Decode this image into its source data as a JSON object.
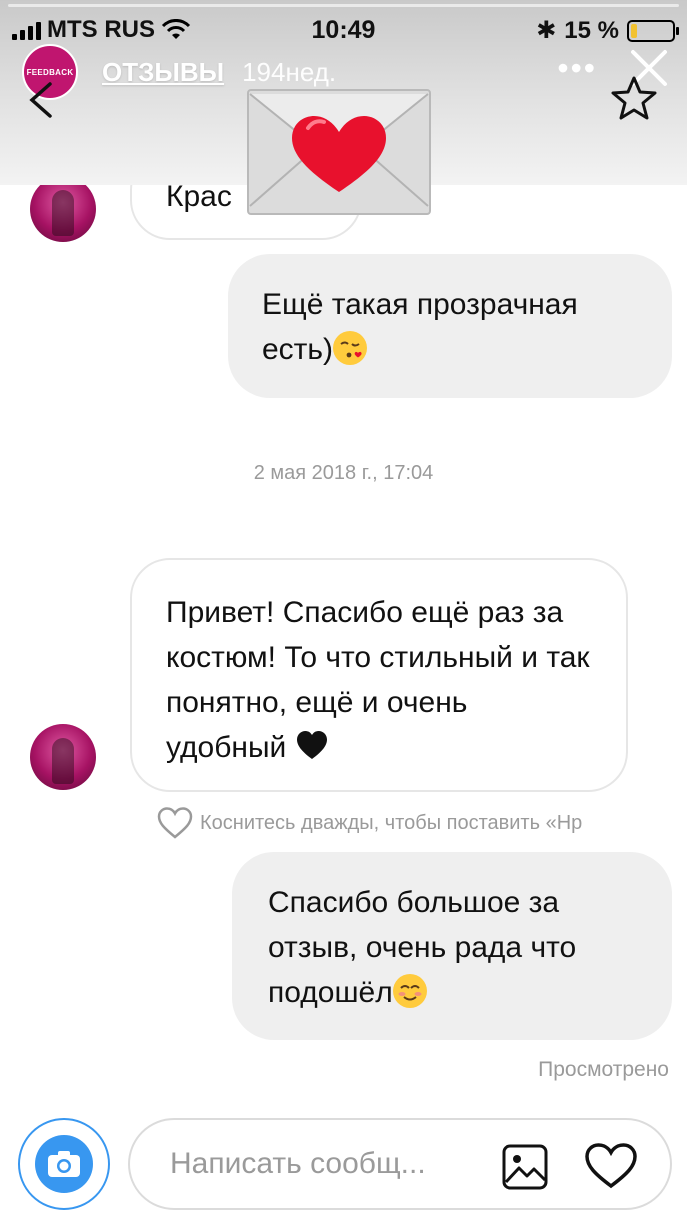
{
  "status_bar": {
    "carrier": "MTS RUS",
    "time": "10:49",
    "battery": "15 %",
    "battery_level": 0.15
  },
  "story": {
    "avatar_label": "FEEDBACK",
    "name": "ОТЗЫВЫ",
    "age": "194нед.",
    "more": "•••"
  },
  "messages": {
    "partial_incoming": "Крас",
    "outgoing_1": "Ещё такая прозрачная есть)",
    "timestamp": "2 мая 2018 г., 17:04",
    "incoming_1": "Привет! Спасибо ещё раз за костюм! То что стильный и так понятно, ещё и очень удобный",
    "like_hint": "Коснитесь дважды, чтобы поставить «Нр",
    "outgoing_2": "Спасибо большое за отзыв, очень рада что подошёл",
    "seen": "Просмотрено"
  },
  "composer": {
    "placeholder": "Написать сообщ..."
  },
  "colors": {
    "accent": "#3897f0",
    "story_avatar": "#c0156f",
    "bubble_out": "#efefef"
  }
}
